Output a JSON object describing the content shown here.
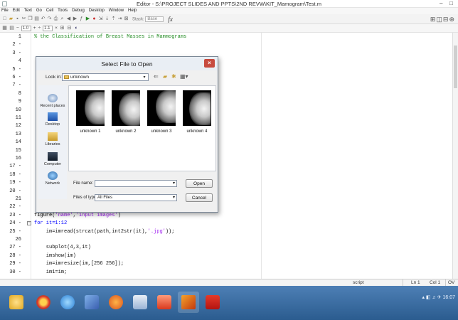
{
  "window": {
    "title": "Editor - S:\\PROJECT SLIDES AND PPTS\\2ND REVW\\KIT_Mamogram\\Test.m",
    "controls": [
      "–",
      "□"
    ]
  },
  "menu": [
    "File",
    "Edit",
    "Text",
    "Go",
    "Cell",
    "Tools",
    "Debug",
    "Desktop",
    "Window",
    "Help"
  ],
  "toolbar": {
    "stack_label": "Stack:",
    "stack_value": "Base",
    "fx": "fx"
  },
  "cell_toolbar": {
    "minus": "−",
    "val1": "1.0",
    "plus": "+",
    "div": "÷",
    "val2": "1.1",
    "times": "×"
  },
  "editor": {
    "lines": [
      {
        "n": "1",
        "text": "% the Classification of Breast Masses in Mammograms",
        "type": "comment"
      },
      {
        "n": "2 -",
        "text": "",
        "type": "code"
      },
      {
        "n": "3 -",
        "text": "",
        "type": "code"
      },
      {
        "n": "4",
        "text": "",
        "type": "code"
      },
      {
        "n": "5 -",
        "text": "",
        "type": "code"
      },
      {
        "n": "6 -",
        "text": "",
        "type": "code"
      },
      {
        "n": "7 -",
        "text": "",
        "type": "code"
      },
      {
        "n": "8",
        "text": "",
        "type": "code"
      },
      {
        "n": "9",
        "text": "",
        "type": "code"
      },
      {
        "n": "10",
        "text": "",
        "type": "code"
      },
      {
        "n": "11",
        "text": "",
        "type": "code"
      },
      {
        "n": "12",
        "text": "",
        "type": "code"
      },
      {
        "n": "13",
        "text": "",
        "type": "code"
      },
      {
        "n": "14",
        "text": "",
        "type": "code"
      },
      {
        "n": "15",
        "text": "",
        "type": "code"
      },
      {
        "n": "16",
        "text": "",
        "type": "code"
      },
      {
        "n": "17 -",
        "text": "",
        "type": "code"
      },
      {
        "n": "18 -",
        "text": "",
        "type": "code"
      },
      {
        "n": "19 -",
        "text": "",
        "type": "code"
      },
      {
        "n": "20 -",
        "text": "",
        "type": "code"
      },
      {
        "n": "21",
        "text": "",
        "type": "code"
      },
      {
        "n": "22 -",
        "text": "",
        "type": "code"
      },
      {
        "n": "23 -",
        "text": "figure('name','input images')",
        "type": "code"
      },
      {
        "n": "24 -",
        "text": "for it=1:12",
        "type": "kw"
      },
      {
        "n": "25 -",
        "text": "    im=imread(strcat(path,int2str(it),'.jpg'));",
        "type": "code"
      },
      {
        "n": "26",
        "text": "",
        "type": "code"
      },
      {
        "n": "27 -",
        "text": "    subplot(4,3,it)",
        "type": "code"
      },
      {
        "n": "28 -",
        "text": "    imshow(im)",
        "type": "code"
      },
      {
        "n": "29 -",
        "text": "    im=imresize(im,[256 256]);",
        "type": "code"
      },
      {
        "n": "30 -",
        "text": "    im1=im;",
        "type": "code"
      }
    ]
  },
  "statusbar": {
    "mode": "script",
    "ln": "Ln  1",
    "col": "Col  1",
    "ovr": "OV"
  },
  "dialog": {
    "title": "Select File to Open",
    "close": "×",
    "lookin_label": "Look in:",
    "lookin_value": "unknown",
    "places": [
      {
        "label": "Recent places",
        "icon": "recent-places-icon"
      },
      {
        "label": "Desktop",
        "icon": "desktop-icon"
      },
      {
        "label": "Libraries",
        "icon": "libraries-icon"
      },
      {
        "label": "Computer",
        "icon": "computer-icon"
      },
      {
        "label": "Network",
        "icon": "network-icon"
      }
    ],
    "files": [
      "unknown 1",
      "unknown 2",
      "unknown 3",
      "unknown 4"
    ],
    "filename_label": "File name:",
    "filename_value": "",
    "filetype_label": "Files of type:",
    "filetype_value": "All Files",
    "open_button": "Open",
    "cancel_button": "Cancel"
  },
  "tray": {
    "time": "16:07"
  },
  "colors": {
    "comment": "#228b22",
    "keyword": "#0000ff",
    "taskbar": "#3a6da3",
    "close": "#c74b3f"
  }
}
